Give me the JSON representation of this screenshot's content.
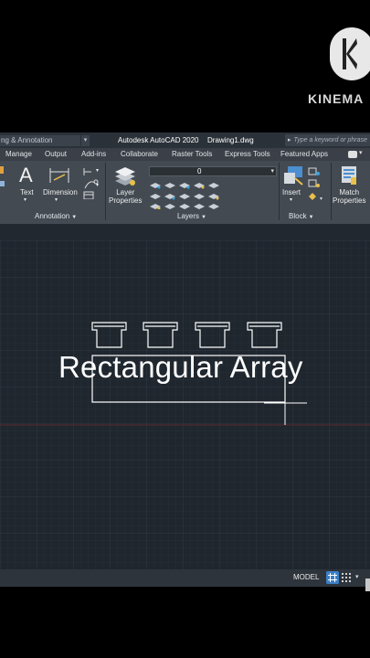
{
  "watermark": {
    "text": "KINEMA"
  },
  "titlebar": {
    "workspace": "ng & Annotation",
    "title": "Autodesk AutoCAD 2020",
    "file": "Drawing1.dwg",
    "search_placeholder": "Type a keyword or phrase"
  },
  "tabs": [
    "Manage",
    "Output",
    "Add-ins",
    "Collaborate",
    "Raster Tools",
    "Express Tools",
    "Featured Apps"
  ],
  "ribbon": {
    "text_label": "Text",
    "dimension_label": "Dimension",
    "annotation_panel": "Annotation",
    "layer_properties_label": "Layer\nProperties",
    "layer_value": "0",
    "layers_panel": "Layers",
    "insert_label": "Insert",
    "block_panel": "Block",
    "match_properties_label": "Match\nProperties"
  },
  "canvas": {
    "caption": "Rectangular Array"
  },
  "statusbar": {
    "model": "MODEL"
  },
  "colors": {
    "canvas": "#1f262e",
    "ribbon": "#434a52",
    "grid_active": "#3a7fc8"
  }
}
